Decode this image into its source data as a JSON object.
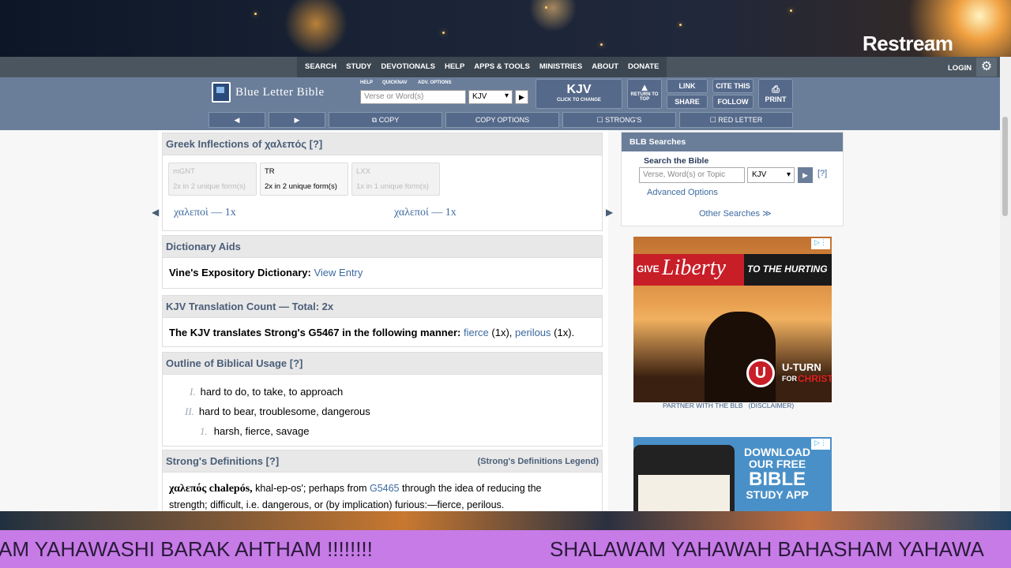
{
  "overlay": {
    "brand": "Restream",
    "ticker_left": "AM YAHAWASHI BARAK AHTHAM !!!!!!!!",
    "ticker_right": "SHALAWAM YAHAWAH BAHASHAM YAHAWA"
  },
  "topnav": {
    "items": [
      "SEARCH",
      "STUDY",
      "DEVOTIONALS",
      "HELP",
      "APPS & TOOLS",
      "MINISTRIES",
      "ABOUT",
      "DONATE"
    ],
    "login": "LOGIN"
  },
  "header": {
    "site_name": "Blue Letter Bible",
    "mini_links": [
      "HELP",
      "QUICKNAV",
      "ADV. OPTIONS"
    ],
    "verse_placeholder": "Verse or Word(s)",
    "version": "KJV",
    "kjv_big": "KJV",
    "kjv_small": "CLICK TO CHANGE",
    "return_top": "RETURN TO TOP",
    "link": "LINK",
    "share": "SHARE",
    "cite": "CITE THIS",
    "follow": "FOLLOW",
    "print": "PRINT"
  },
  "toolbar": {
    "prev": "◀",
    "next": "▶",
    "copy": "COPY",
    "copy_options": "COPY OPTIONS",
    "strongs": "STRONG'S",
    "red_letter": "RED LETTER"
  },
  "inflections": {
    "title": "Greek Inflections of χαλεπός [?]",
    "tabs": [
      {
        "name": "mGNT",
        "count": "2x in 2 unique form(s)"
      },
      {
        "name": "TR",
        "count": "2x in 2 unique form(s)"
      },
      {
        "name": "LXX",
        "count": "1x in 1 unique form(s)"
      }
    ],
    "forms": [
      "χαλεποὶ — 1x",
      "χαλεποί — 1x"
    ]
  },
  "dictionary": {
    "title": "Dictionary Aids",
    "label": "Vine's Expository Dictionary:",
    "link": "View Entry"
  },
  "translation": {
    "title": "KJV Translation Count — Total: 2x",
    "lead": "The KJV translates Strong's G5467 in the following manner:",
    "w1": "fierce",
    "c1": "(1x),",
    "w2": "perilous",
    "c2": "(1x)."
  },
  "outline": {
    "title": "Outline of Biblical Usage [?]",
    "items": [
      {
        "num": "I.",
        "text": "hard to do, to take, to approach"
      },
      {
        "num": "II.",
        "text": "hard to bear, troublesome, dangerous"
      },
      {
        "num": "1.",
        "text": "harsh, fierce, savage"
      }
    ]
  },
  "strongs": {
    "title": "Strong's Definitions [?]",
    "legend": "(Strong's Definitions Legend)",
    "word": "χαλεπός chalepós,",
    "p1": "khal-ep-os'; perhaps from",
    "ref": "G5465",
    "p2": "through the idea of reducing the",
    "line2": "strength; difficult, i.e. dangerous, or (by implication) furious:—fierce, perilous."
  },
  "sidebar": {
    "title": "BLB Searches",
    "search_label": "Search the Bible",
    "search_placeholder": "Verse, Word(s) or Topic",
    "version": "KJV",
    "help": "[?]",
    "advanced": "Advanced Options",
    "other": "Other Searches ≫"
  },
  "ad1": {
    "give": "GIVE",
    "liberty": "Liberty",
    "rest": "TO THE HURTING",
    "u_turn": "U-TURN",
    "for": "FOR",
    "christ": "CHRIST",
    "partner": "PARTNER WITH THE BLB",
    "disclaimer": "(DISCLAIMER)"
  },
  "ad2": {
    "l1": "DOWNLOAD",
    "l2": "OUR FREE",
    "l3": "BIBLE",
    "l4": "STUDY APP"
  }
}
